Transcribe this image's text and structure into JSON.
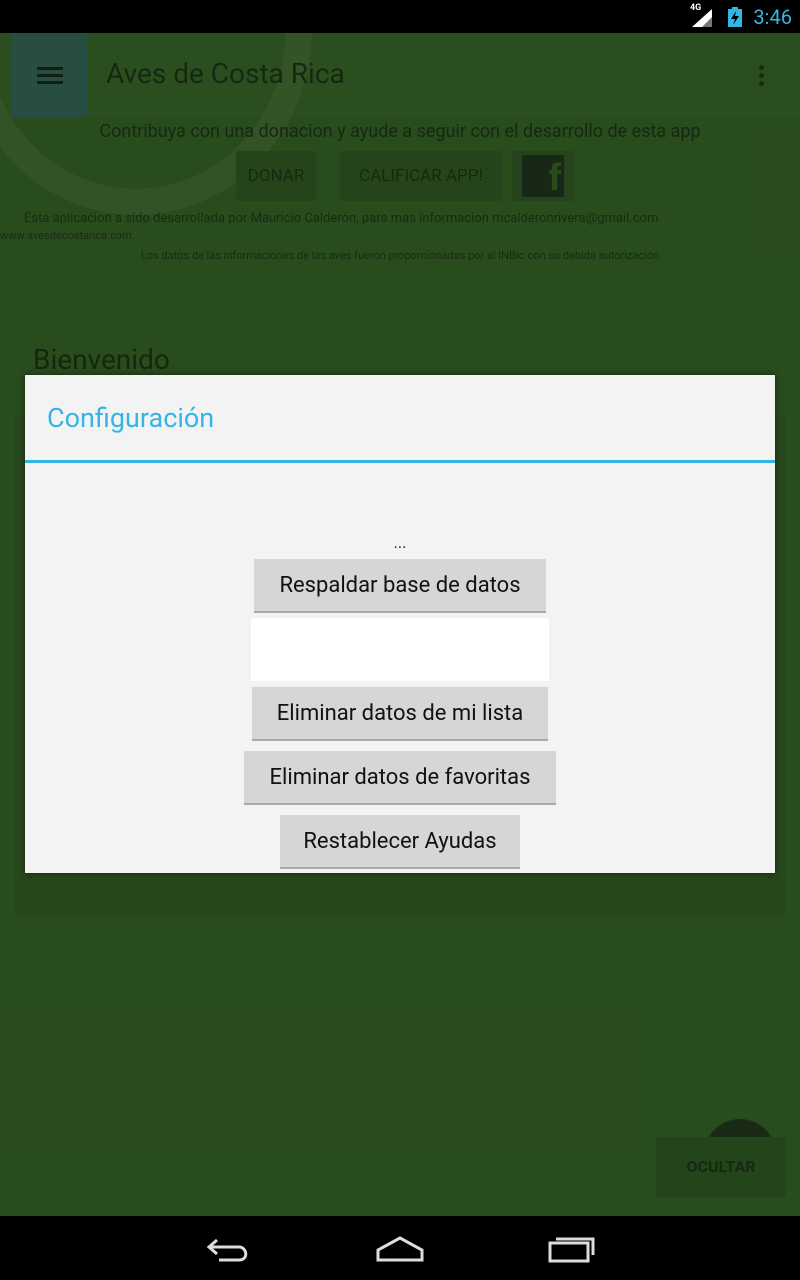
{
  "status_bar": {
    "network_label": "4G",
    "time": "3:46",
    "accent_color": "#33b5e5"
  },
  "app": {
    "title": "Aves de Costa Rica",
    "contribution_text": "Contribuya con una donacion y ayude a seguir con el desarrollo de esta app",
    "donar_label": "DONAR",
    "calificar_label": "CALIFICAR APP!",
    "facebook_icon_glyph": "f",
    "credit_line_1": "Esta aplicacion a sido desarrollada por Mauricio Calderón, para mas informacion mcalderonrivera@gmail.com",
    "credit_line_2": "www.avesdecostarica.com",
    "credit_line_3": "Los datos de las informaciones de las aves fueron proporcionadas por el INBio con su debida autorización",
    "welcome_heading": "Bienvenido",
    "ocultar_label": "OCULTAR"
  },
  "dialog": {
    "title": "Configuración",
    "status_text": "...",
    "buttons": {
      "backup": "Respaldar base de datos",
      "delete_list": "Eliminar datos de mi lista",
      "delete_favorites": "Eliminar datos de favoritas",
      "reset_help": "Restablecer Ayudas"
    }
  },
  "nav_bar": {
    "back_icon": "back-icon",
    "home_icon": "home-icon",
    "recents_icon": "recents-icon"
  }
}
